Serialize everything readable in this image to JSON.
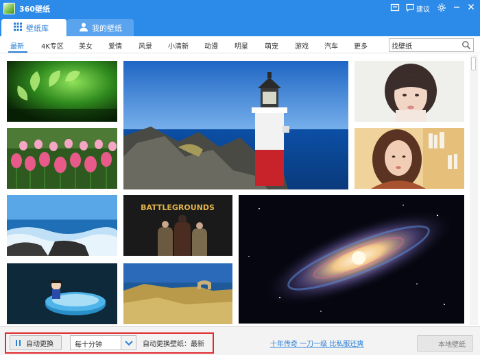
{
  "window": {
    "title": "360壁纸",
    "feedback_label": "建议"
  },
  "tabs": [
    {
      "label": "壁纸库",
      "active": true
    },
    {
      "label": "我的壁纸",
      "active": false
    }
  ],
  "categories": [
    "最新",
    "4K专区",
    "美女",
    "爱情",
    "风景",
    "小清新",
    "动漫",
    "明星",
    "萌宠",
    "游戏",
    "汽车",
    "更多"
  ],
  "search": {
    "value": "找壁纸"
  },
  "tiles": [
    {
      "name": "wallpaper-ginkgo-leaves"
    },
    {
      "name": "wallpaper-lighthouse"
    },
    {
      "name": "wallpaper-girl-portrait"
    },
    {
      "name": "wallpaper-tulips"
    },
    {
      "name": "wallpaper-girl-bookshelf"
    },
    {
      "name": "wallpaper-ocean-waves"
    },
    {
      "name": "wallpaper-battlegrounds",
      "text": "BATTLEGROUNDS"
    },
    {
      "name": "wallpaper-galaxy"
    },
    {
      "name": "wallpaper-pool-toy"
    },
    {
      "name": "wallpaper-coast-arch"
    }
  ],
  "bottom": {
    "auto_change_label": "自动更换",
    "interval_value": "每十分钟",
    "status_text": "自动更换壁纸：最新",
    "ad_text": "十年传奇 一刀一级 比私服还爽",
    "local_button_label": "本地壁纸"
  },
  "colors": {
    "accent": "#2c8ae8",
    "highlight_box": "#e0282e"
  }
}
